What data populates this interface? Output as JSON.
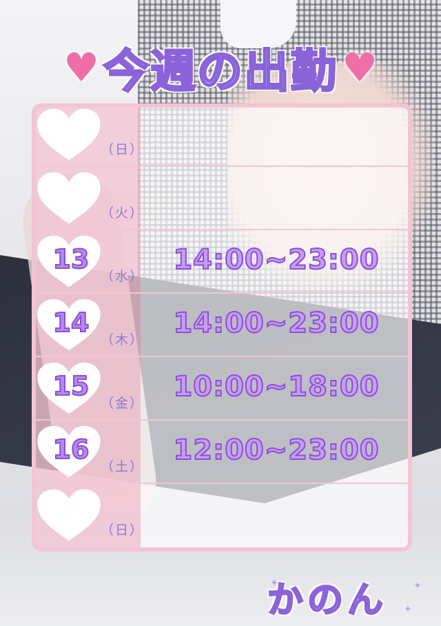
{
  "title": {
    "text": "今週の出勤",
    "heart_left": "♥",
    "heart_right": "♥"
  },
  "schedule": [
    {
      "date": "",
      "weekday": "（日）",
      "time": ""
    },
    {
      "date": "",
      "weekday": "（火）",
      "time": ""
    },
    {
      "date": "13",
      "weekday": "（水）",
      "time": "14:00~23:00"
    },
    {
      "date": "14",
      "weekday": "（木）",
      "time": "14:00~23:00"
    },
    {
      "date": "15",
      "weekday": "（金）",
      "time": "10:00~18:00"
    },
    {
      "date": "16",
      "weekday": "（土）",
      "time": "12:00~23:00"
    },
    {
      "date": "",
      "weekday": "（日）",
      "time": ""
    }
  ],
  "name": "かのん",
  "colors": {
    "accent_pink": "#ee6fa7",
    "accent_purple": "#8b63d9",
    "panel_pink": "#f3c4d4"
  }
}
